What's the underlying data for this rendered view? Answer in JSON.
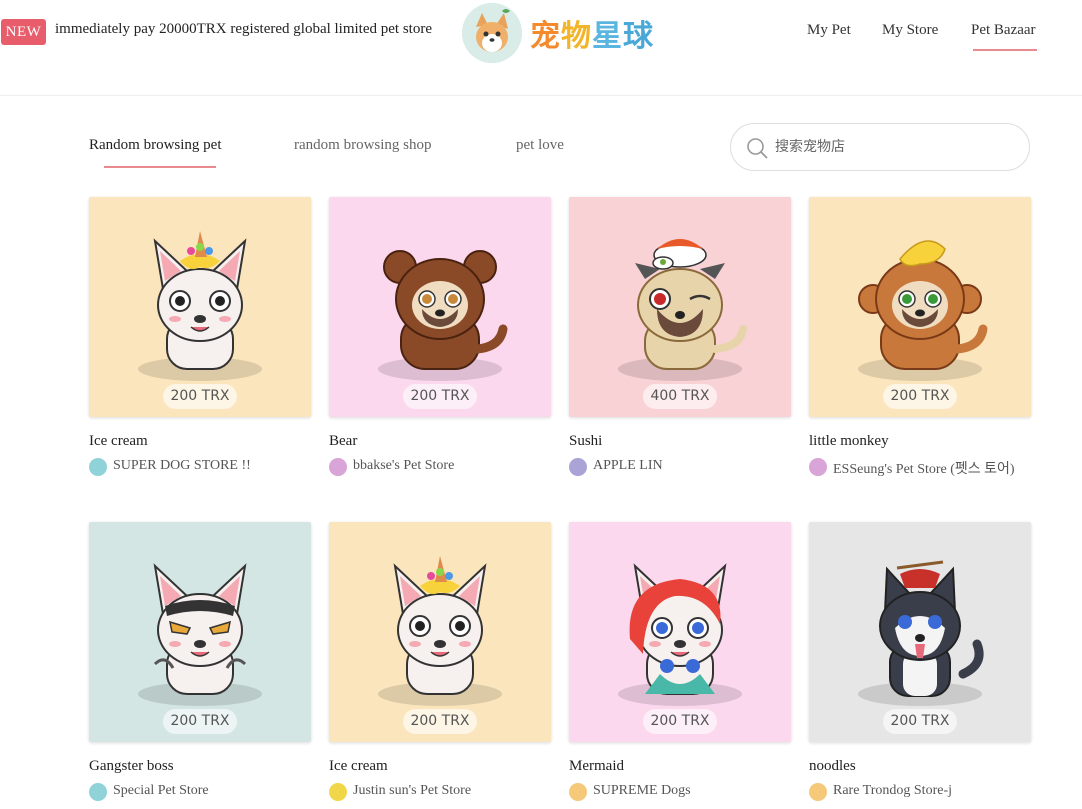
{
  "header": {
    "new_badge": "NEW",
    "announcement": "immediately pay 20000TRX registered global limited pet store",
    "logo_text": [
      "宠",
      "物",
      "星",
      "球"
    ],
    "nav": [
      {
        "label": "My Pet"
      },
      {
        "label": "My Store"
      },
      {
        "label": "Pet Bazaar",
        "active": true
      }
    ]
  },
  "tabs": [
    {
      "label": "Random browsing pet",
      "active": true
    },
    {
      "label": "random browsing shop"
    },
    {
      "label": "pet love"
    }
  ],
  "search": {
    "placeholder": "搜索宠物店",
    "value": ""
  },
  "pets": [
    {
      "name": "Ice cream",
      "price": "200 TRX",
      "store": "SUPER DOG STORE !!",
      "bg": "#fbe5bd",
      "avatar_color": "#8fd3d8",
      "pet_icon": "bulldog-ice-cream-icon"
    },
    {
      "name": "Bear",
      "price": "200 TRX",
      "store": "bbakse's Pet Store",
      "bg": "#fbd8ee",
      "avatar_color": "#d9a4d8",
      "pet_icon": "pug-bear-costume-icon"
    },
    {
      "name": "Sushi",
      "price": "400 TRX",
      "store": "APPLE LIN",
      "bg": "#f9d2d5",
      "avatar_color": "#a9a3d6",
      "pet_icon": "pug-sushi-icon"
    },
    {
      "name": "little monkey",
      "price": "200 TRX",
      "store": "ESSeung's Pet Store (펫스 토어)",
      "bg": "#fbe5bd",
      "avatar_color": "#d9a4d8",
      "pet_icon": "pug-monkey-costume-icon"
    },
    {
      "name": "Gangster boss",
      "price": "200 TRX",
      "store": "Special Pet Store",
      "bg": "#d3e6e4",
      "avatar_color": "#8fd3d8",
      "pet_icon": "bulldog-gangster-icon"
    },
    {
      "name": "Ice cream",
      "price": "200 TRX",
      "store": "Justin sun's Pet Store",
      "bg": "#fbe5bd",
      "avatar_color": "#f2d64a",
      "pet_icon": "bulldog-ice-cream-icon"
    },
    {
      "name": "Mermaid",
      "price": "200 TRX",
      "store": "SUPREME Dogs",
      "bg": "#fbd8ee",
      "avatar_color": "#f4c97a",
      "pet_icon": "bulldog-mermaid-icon"
    },
    {
      "name": "noodles",
      "price": "200 TRX",
      "store": "Rare Trondog Store-j",
      "bg": "#e6e6e6",
      "avatar_color": "#f4c97a",
      "pet_icon": "husky-noodles-icon"
    }
  ]
}
